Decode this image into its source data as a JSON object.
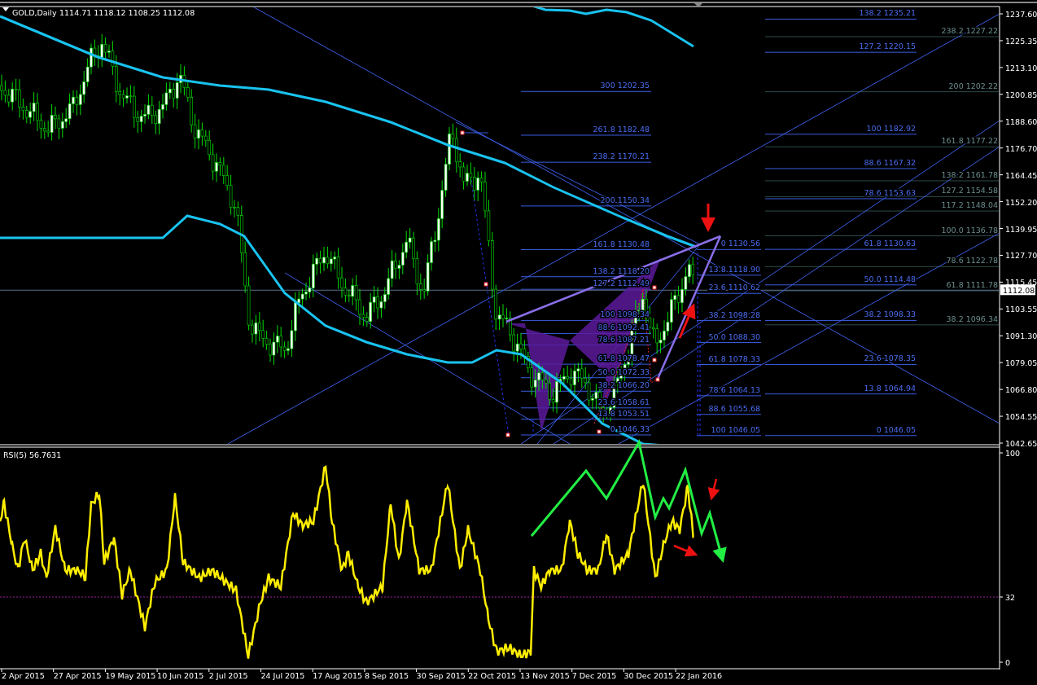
{
  "chart_title": {
    "symbol": "GOLD,Daily",
    "ohlc": "1114.71 1118.12 1108.25 1112.08"
  },
  "price_axis": {
    "ticks": [
      "1237.60",
      "1225.35",
      "1213.10",
      "1200.85",
      "1188.60",
      "1176.70",
      "1164.45",
      "1152.20",
      "1139.95",
      "1127.70",
      "1115.45",
      "1103.55",
      "1091.30",
      "1079.05",
      "1066.80",
      "1054.55",
      "1042.65"
    ],
    "current_price": "1112.08"
  },
  "fib_sets": [
    {
      "levels": [
        "300 1202.35",
        "261.8 1182.48",
        "238.2 1170.21",
        "200 1150.34",
        "161.8 1130.48",
        "138.2 1118.20",
        "127.2 1112.49",
        "100 1098.34",
        "88.6 1092.41",
        "78.6 1087.21",
        "61.8 1078.47",
        "50.0 1072.33",
        "38.2 1066.20",
        "23.6 1058.61",
        "13.8 1053.51",
        "0 1046.33"
      ]
    },
    {
      "levels": [
        "0 1130.56",
        "13.8 1118.90",
        "23.6 1110.62",
        "38.2 1098.28",
        "50.0 1088.30",
        "61.8 1078.33",
        "78.6 1064.13",
        "88.6 1055.68",
        "100 1046.05"
      ]
    },
    {
      "levels": [
        "138.2 1235.21",
        "127.2 1220.15",
        "100 1182.92",
        "88.6 1167.32",
        "78.6 1153.63",
        "61.8 1130.63",
        "50.0 1114.48",
        "38.2 1098.33",
        "23.6 1078.35",
        "13.8 1064.94",
        "0 1046.05"
      ]
    },
    {
      "levels": [
        "238.2 1227.22",
        "200 1202.22",
        "161.8 1177.22",
        "138.2 1161.78",
        "127.2 1154.58",
        "117.2 1148.04",
        "100.0 1136.78",
        "78.6 1122.78",
        "61.8 1111.78",
        "38.2 1096.34"
      ]
    }
  ],
  "rsi": {
    "label": "RSI(5) 56.7631",
    "ticks": [
      "100",
      "32",
      "0"
    ]
  },
  "date_axis": [
    "2 Apr 2015",
    "27 Apr 2015",
    "19 May 2015",
    "10 Jun 2015",
    "2 Jul 2015",
    "24 Jul 2015",
    "17 Aug 2015",
    "8 Sep 2015",
    "30 Sep 2015",
    "22 Oct 2015",
    "13 Nov 2015",
    "7 Dec 2015",
    "30 Dec 2015",
    "22 Jan 2016"
  ]
}
